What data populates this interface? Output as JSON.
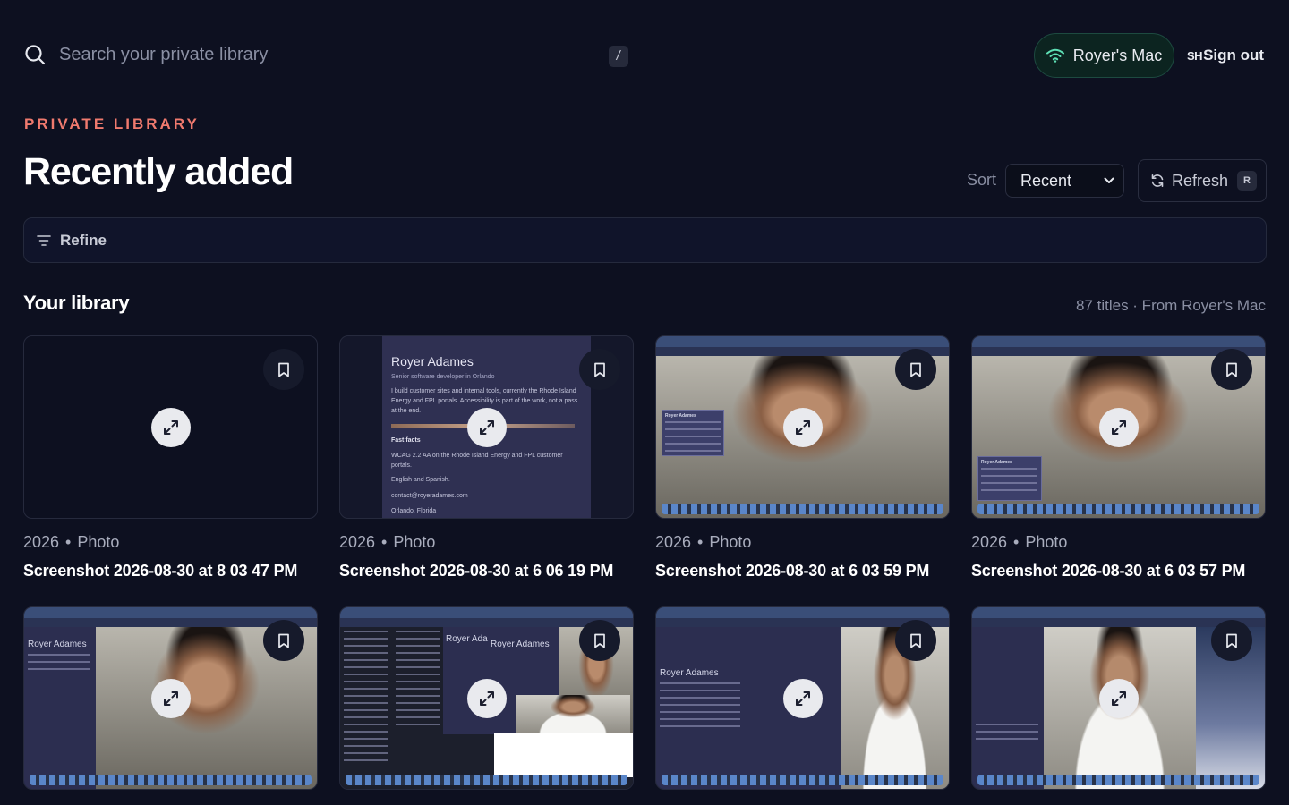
{
  "search": {
    "placeholder": "Search your private library",
    "shortcut": "/"
  },
  "device": {
    "label": "Royer's Mac"
  },
  "account": {
    "avatar_initials": "SH",
    "sign_out_label": "Sign out"
  },
  "header": {
    "eyebrow": "PRIVATE LIBRARY",
    "title": "Recently added"
  },
  "sort": {
    "label": "Sort",
    "selected": "Recent"
  },
  "refresh": {
    "label": "Refresh",
    "shortcut": "R"
  },
  "refine": {
    "label": "Refine"
  },
  "library": {
    "title": "Your library",
    "meta": "87 titles · From Royer's Mac"
  },
  "items": [
    {
      "year": "2026",
      "type": "Photo",
      "title": "Screenshot 2026-08-30 at 8 03 47 PM"
    },
    {
      "year": "2026",
      "type": "Photo",
      "title": "Screenshot 2026-08-30 at 6 06 19 PM",
      "preview": {
        "name": "Royer Adames",
        "role": "Senior software developer in Orlando",
        "intro": "I build customer sites and internal tools, currently the Rhode Island Energy and FPL portals. Accessibility is part of the work, not a pass at the end.",
        "facts_heading": "Fast facts",
        "fact1": "WCAG 2.2 AA on the Rhode Island Energy and FPL customer portals.",
        "fact2": "English and Spanish.",
        "email": "contact@royeradames.com",
        "location": "Orlando, Florida"
      }
    },
    {
      "year": "2026",
      "type": "Photo",
      "title": "Screenshot 2026-08-30 at 6 03 59 PM",
      "preview": {
        "name": "Royer Adames"
      }
    },
    {
      "year": "2026",
      "type": "Photo",
      "title": "Screenshot 2026-08-30 at 6 03 57 PM",
      "preview": {
        "name": "Royer Adames"
      }
    },
    {
      "preview": {
        "name": "Royer Adames"
      }
    },
    {
      "preview": {
        "name": "Royer Ada",
        "name2": "Royer Adames"
      }
    },
    {
      "preview": {
        "name": "Royer Adames"
      }
    },
    {
      "preview": {}
    }
  ],
  "colors": {
    "background": "#0d1020",
    "accent": "#f07a6e",
    "device_pill": "#0c2420"
  },
  "icons": [
    "search-icon",
    "wifi-icon",
    "chevron-down-icon",
    "refresh-icon",
    "filter-icon",
    "bookmark-icon",
    "expand-icon"
  ]
}
